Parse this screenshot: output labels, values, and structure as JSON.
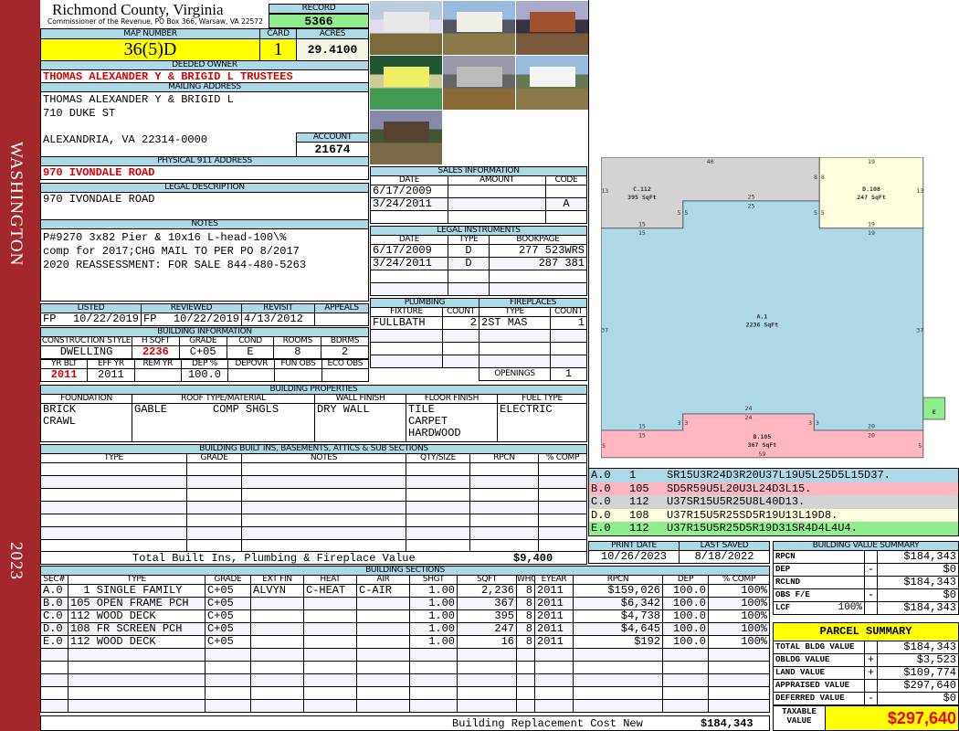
{
  "sidebar": {
    "district": "WASHINGTON",
    "year": "2023"
  },
  "header": {
    "title": "Richmond County, Virginia",
    "subtitle": "Commissioner of the Revenue, PO Box 366, Warsaw, VA 22572",
    "record_label": "RECORD",
    "record": "5366"
  },
  "parcel": {
    "map_label": "MAP NUMBER",
    "map": "36(5)D",
    "card_label": "CARD",
    "card": "1",
    "acres_label": "ACRES",
    "acres": "29.4100"
  },
  "owner": {
    "label": "DEEDED OWNER",
    "name": "THOMAS ALEXANDER Y & BRIGID L TRUSTEES"
  },
  "mailing": {
    "label": "MAILING ADDRESS",
    "line1": "THOMAS ALEXANDER Y & BRIGID L",
    "line2": "710 DUKE ST",
    "line3": "ALEXANDRIA, VA 22314-0000",
    "account_label": "ACCOUNT",
    "account": "21674"
  },
  "physical": {
    "label": "PHYSICAL 911 ADDRESS",
    "address": "970 IVONDALE ROAD"
  },
  "legal": {
    "label": "LEGAL DESCRIPTION",
    "text": "970 IVONDALE ROAD"
  },
  "notes": {
    "label": "NOTES",
    "lines": [
      "P#9270 3x82 Pier & 10x16 L-head-100\\%",
      "comp for 2017;CHG MAIL TO PER PO 8/2017",
      "2020 REASSESSMENT: FOR SALE 844-480-5263"
    ]
  },
  "review": {
    "headers": [
      "LISTED",
      "REVIEWED",
      "REVISIT",
      "APPEALS"
    ],
    "listed_by": "FP",
    "listed": "10/22/2019",
    "reviewed_by": "FP",
    "reviewed": "10/22/2019",
    "revisit": "4/13/2012",
    "appeals": ""
  },
  "building_info": {
    "label": "BUILDING INFORMATION",
    "headers1": [
      "CONSTRUCTION STYLE",
      "H SQFT",
      "GRADE",
      "COND",
      "ROOMS",
      "BDRMS"
    ],
    "values1": [
      "DWELLING",
      "2236",
      "C+05",
      "E",
      "8",
      "2"
    ],
    "headers2": [
      "YR BLT",
      "EFF YR",
      "REM YR",
      "DEP %",
      "DEPOVR",
      "FUN OBS",
      "ECO OBS"
    ],
    "values2": [
      "2011",
      "2011",
      "",
      "100.0",
      "",
      "",
      ""
    ]
  },
  "sales": {
    "label": "SALES INFORMATION",
    "headers": [
      "DATE",
      "AMOUNT",
      "CODE"
    ],
    "rows": [
      [
        "6/17/2009",
        "",
        ""
      ],
      [
        "3/24/2011",
        "",
        "A"
      ]
    ]
  },
  "instruments": {
    "label": "LEGAL INSTRUMENTS",
    "headers": [
      "DATE",
      "TYPE",
      "BOOKPAGE"
    ],
    "rows": [
      [
        "6/17/2009",
        "D",
        "277 523WRS"
      ],
      [
        "3/24/2011",
        "D",
        "287 381"
      ]
    ]
  },
  "plumbing": {
    "label": "PLUMBING",
    "headers": [
      "FIXTURE",
      "COUNT"
    ],
    "rows": [
      [
        "FULLBATH",
        "2"
      ]
    ]
  },
  "fireplaces": {
    "label": "FIREPLACES",
    "headers": [
      "TYPE",
      "COUNT"
    ],
    "rows": [
      [
        "2ST MAS",
        "1"
      ]
    ],
    "openings_label": "OPENINGS",
    "openings": "1"
  },
  "properties": {
    "label": "BUILDING PROPERTIES",
    "headers": [
      "FOUNDATION",
      "ROOF TYPE/MATERIAL",
      "WALL FINISH",
      "FLOOR FINISH",
      "FUEL TYPE"
    ],
    "foundation": [
      "BRICK",
      "CRAWL"
    ],
    "roof_type": "GABLE",
    "roof_material": "COMP SHGLS",
    "wall": [
      "DRY WALL"
    ],
    "floor": [
      "TILE",
      "CARPET",
      "HARDWOOD"
    ],
    "fuel": [
      "ELECTRIC"
    ]
  },
  "builtins": {
    "label": "BUILDING BUILT INS, BASEMENTS, ATTICS & SUB SECTIONS",
    "headers": [
      "TYPE",
      "GRADE",
      "NOTES",
      "QTY/SIZE",
      "RPCN",
      "% COMP"
    ],
    "total_label": "Total Built Ins, Plumbing & Fireplace Value",
    "total": "$9,400"
  },
  "sections": {
    "label": "BUILDING SECTIONS",
    "headers": [
      "SEC#",
      "TYPE",
      "GRADE",
      "EXT FIN",
      "HEAT",
      "AIR",
      "SHGT",
      "SQFT",
      "WHGT",
      "EYEAR",
      "RPCN",
      "DEP",
      "% COMP"
    ],
    "rows": [
      [
        "A.0",
        "  1 SINGLE FAMILY",
        "C+05",
        "ALVYN",
        "C-HEAT",
        "C-AIR",
        "1.00",
        "2,236",
        "8",
        "2011",
        "$159,026",
        "100.0",
        "100%"
      ],
      [
        "B.0",
        "105 OPEN FRAME PCH",
        "C+05",
        "",
        "",
        "",
        "1.00",
        "367",
        "8",
        "2011",
        "$6,342",
        "100.0",
        "100%"
      ],
      [
        "C.0",
        "112 WOOD DECK",
        "C+05",
        "",
        "",
        "",
        "1.00",
        "395",
        "8",
        "2011",
        "$4,738",
        "100.0",
        "100%"
      ],
      [
        "D.0",
        "108 FR SCREEN PCH",
        "C+05",
        "",
        "",
        "",
        "1.00",
        "247",
        "8",
        "2011",
        "$4,645",
        "100.0",
        "100%"
      ],
      [
        "E.0",
        "112 WOOD DECK",
        "C+05",
        "",
        "",
        "",
        "1.00",
        "16",
        "8",
        "2011",
        "$192",
        "100.0",
        "100%"
      ]
    ],
    "total_label": "Building Replacement Cost New",
    "total": "$184,343"
  },
  "sketch": {
    "areas": [
      {
        "id": "A.1",
        "sqft": "2236 SqFt",
        "color": "#add8e6"
      },
      {
        "id": "B.105",
        "sqft": "367 SqFt",
        "color": "#ffb6c1"
      },
      {
        "id": "C.112",
        "sqft": "395 SqFt",
        "color": "#d3d3d3"
      },
      {
        "id": "D.108",
        "sqft": "247 SqFt",
        "color": "#ffffe0"
      },
      {
        "id": "E",
        "sqft": "",
        "color": "#90ee90"
      }
    ],
    "dims": [
      "40",
      "19",
      "13",
      "8",
      "8",
      "13",
      "25",
      "25",
      "5",
      "5",
      "5",
      "5",
      "15",
      "15",
      "19",
      "19",
      "37",
      "37",
      "24",
      "24",
      "3",
      "3",
      "3",
      "3",
      "15",
      "15",
      "20",
      "20",
      "5",
      "5",
      "59"
    ]
  },
  "sketch_codes": [
    {
      "sec": "A.0",
      "code": "1",
      "vector": "SR15U3R24D3R20U37L19U5L25D5L15D37.",
      "color": "#add8e6"
    },
    {
      "sec": "B.0",
      "code": "105",
      "vector": "SD5R59U5L20U3L24D3L15.",
      "color": "#ffb6c1"
    },
    {
      "sec": "C.0",
      "code": "112",
      "vector": "U37SR15U5R25U8L40D13.",
      "color": "#d3d3d3"
    },
    {
      "sec": "D.0",
      "code": "108",
      "vector": "U37R15U5R25SD5R19U13L19D8.",
      "color": "#ffffe0"
    },
    {
      "sec": "E.0",
      "code": "112",
      "vector": "U37R15U5R25D5R19D31SR4D4L4U4.",
      "color": "#90ee90"
    }
  ],
  "dates": {
    "print_label": "PRINT DATE",
    "print": "10/26/2023",
    "saved_label": "LAST SAVED",
    "saved": "8/18/2022"
  },
  "bvs": {
    "label": "BUILDING VALUE SUMMARY",
    "rows": [
      {
        "k": "RPCN",
        "s": "",
        "v": "$184,343"
      },
      {
        "k": "DEP",
        "s": "-",
        "v": "$0"
      },
      {
        "k": "RCLND",
        "s": "",
        "v": "$184,343"
      },
      {
        "k": "OBS F/E",
        "s": "-",
        "v": "$0"
      },
      {
        "k": "LCF",
        "p": "100%",
        "s": "",
        "v": "$184,343"
      }
    ]
  },
  "parcel_summary": {
    "label": "PARCEL SUMMARY",
    "rows": [
      {
        "k": "TOTAL BLDG VALUE",
        "s": "",
        "v": "$184,343"
      },
      {
        "k": "OBLDG VALUE",
        "s": "+",
        "v": "$3,523"
      },
      {
        "k": "LAND VALUE",
        "s": "+",
        "v": "$109,774"
      },
      {
        "k": "APPRAISED VALUE",
        "s": "",
        "v": "$297,640"
      },
      {
        "k": "DEFERRED VALUE",
        "s": "-",
        "v": "$0"
      }
    ],
    "taxable_label": "TAXABLE VALUE",
    "taxable": "$297,640"
  }
}
